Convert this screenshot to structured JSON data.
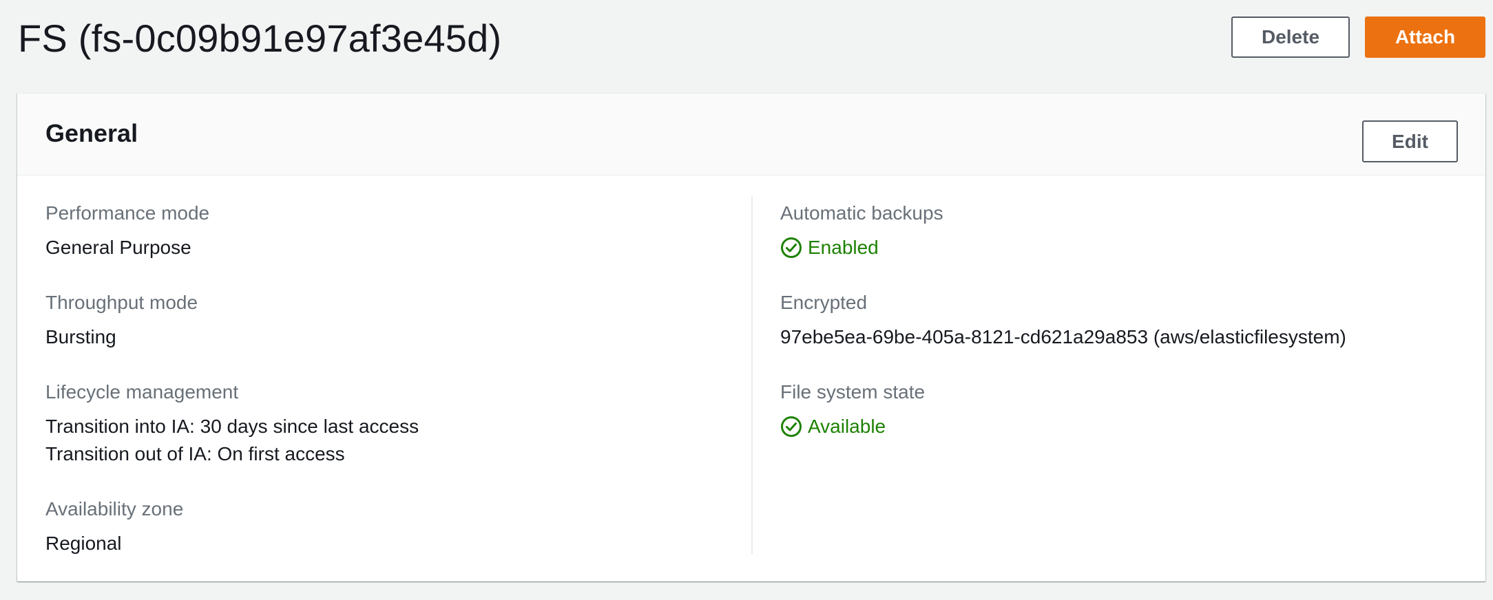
{
  "header": {
    "title": "FS (fs-0c09b91e97af3e45d)",
    "delete_label": "Delete",
    "attach_label": "Attach"
  },
  "panel": {
    "title": "General",
    "edit_label": "Edit",
    "left": {
      "performance_mode": {
        "label": "Performance mode",
        "value": "General Purpose"
      },
      "throughput_mode": {
        "label": "Throughput mode",
        "value": "Bursting"
      },
      "lifecycle_management": {
        "label": "Lifecycle management",
        "lines": [
          "Transition into IA: 30 days since last access",
          "Transition out of IA: On first access"
        ]
      },
      "availability_zone": {
        "label": "Availability zone",
        "value": "Regional"
      }
    },
    "right": {
      "automatic_backups": {
        "label": "Automatic backups",
        "value": "Enabled",
        "icon": "check-circle-icon"
      },
      "encrypted": {
        "label": "Encrypted",
        "value": "97ebe5ea-69be-405a-8121-cd621a29a853 (aws/elasticfilesystem)"
      },
      "file_system_state": {
        "label": "File system state",
        "value": "Available",
        "icon": "check-circle-icon"
      }
    }
  },
  "colors": {
    "primary": "#ec7211",
    "success": "#1d8102",
    "label": "#687078",
    "text": "#16191f"
  }
}
